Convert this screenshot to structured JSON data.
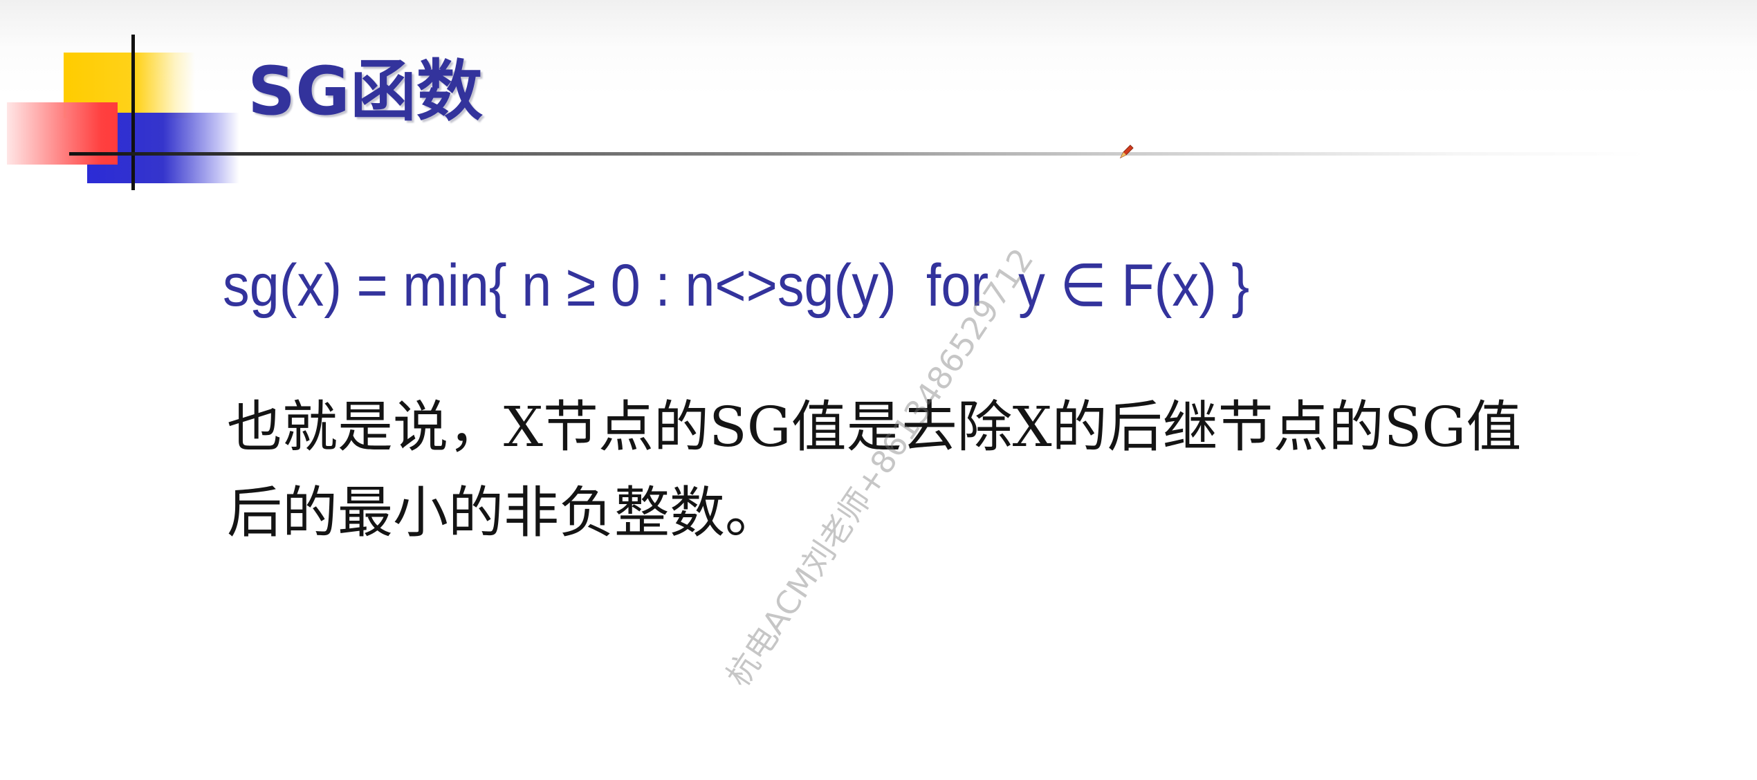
{
  "slide": {
    "title": "SG函数",
    "formula": "sg(x) = min{ n ≥ 0 : n<>sg(y)  for  y ∈ F(x) }",
    "body_lines": [
      "也就是说，X节点的SG值是去除X的后继节点的SG值",
      "后的最小的非负整数。"
    ],
    "watermark": "杭电ACM刘老师+8613486529712"
  },
  "colors": {
    "title": "#33339c",
    "formula": "#33339c",
    "body_text": "#141414",
    "deco_yellow": "#ffcc00",
    "deco_blue": "#2b2bd6",
    "deco_red": "#ff3b3b"
  },
  "icons": {
    "cursor": "pen-icon"
  }
}
